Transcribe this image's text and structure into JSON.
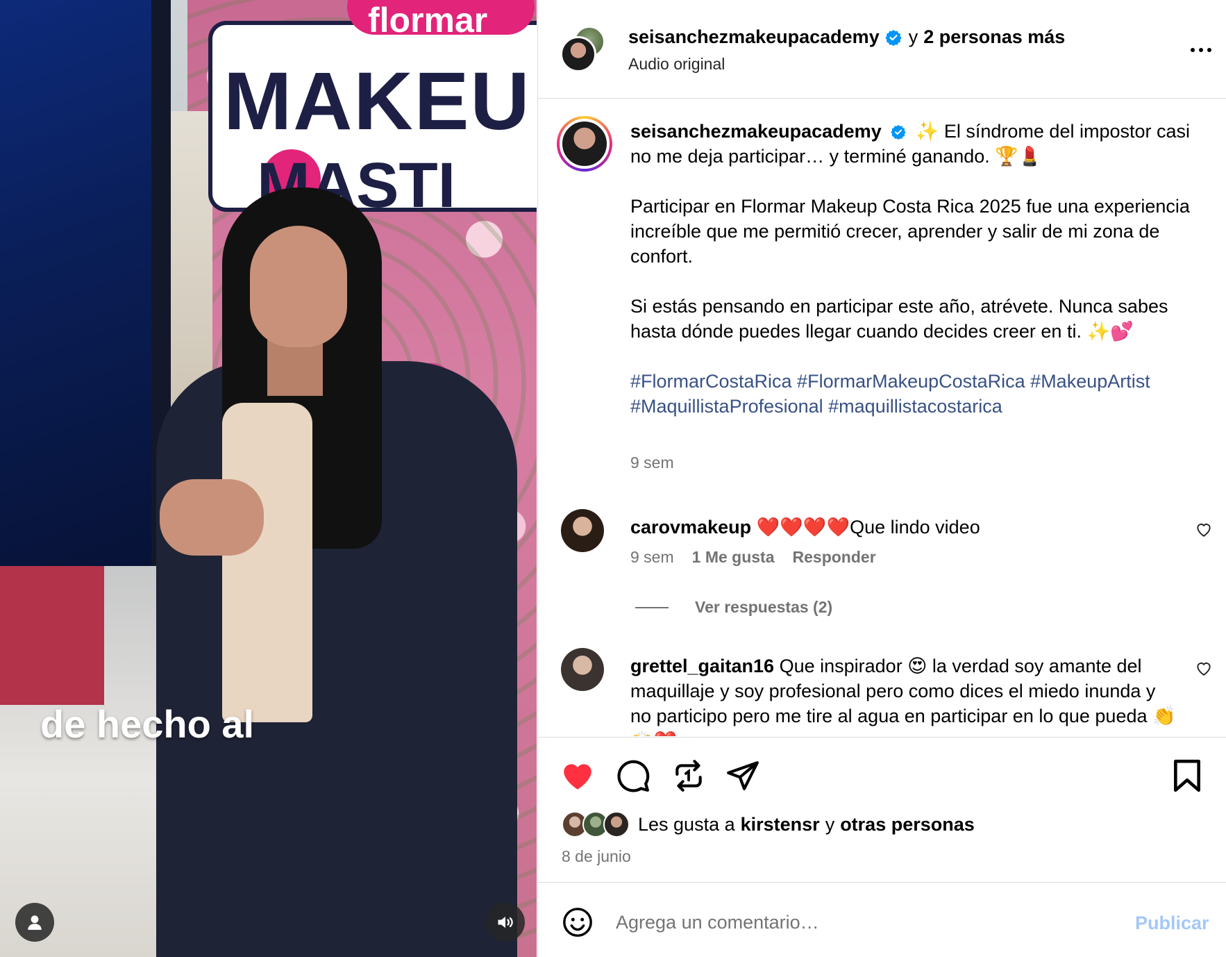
{
  "video": {
    "banner_brand": "flormar",
    "banner_line1": "MAKEU",
    "banner_line2": "MASTI",
    "caption": "de hecho al"
  },
  "header": {
    "username": "seisanchezmakeupacademy",
    "connector": "y",
    "others": "2 personas más",
    "audio": "Audio original"
  },
  "post": {
    "username": "seisanchezmakeupacademy",
    "paragraphs": [
      "✨ El síndrome del impostor casi no me deja participar… y terminé ganando. 🏆💄",
      "Participar en Flormar Makeup Costa Rica 2025 fue una experiencia increíble que me permitió crecer, aprender y salir de mi zona de confort.",
      "Si estás pensando en participar este año, atrévete. Nunca sabes hasta dónde puedes llegar cuando decides creer en ti. ✨💕"
    ],
    "hashtags": "#FlormarCostaRica #FlormarMakeupCostaRica #MakeupArtist #MaquillistaProfesional #maquillistacostarica",
    "time": "9 sem"
  },
  "comments": [
    {
      "username": "carovmakeup",
      "text": "❤️❤️❤️❤️Que lindo video",
      "time": "9 sem",
      "likes": "1 Me gusta",
      "reply": "Responder",
      "view_replies": "Ver respuestas (2)"
    },
    {
      "username": "grettel_gaitan16",
      "text": "Que inspirador 😍 la verdad soy amante del maquillaje y soy profesional pero como dices el miedo inunda y no participo pero me tire al agua en participar en lo que pueda 👏🙌❤️"
    }
  ],
  "likes": {
    "prefix": "Les gusta a",
    "user": "kirstensr",
    "connector": "y",
    "others": "otras personas",
    "date": "8 de junio"
  },
  "composer": {
    "placeholder": "Agrega un comentario…",
    "publish": "Publicar"
  },
  "colors": {
    "like_red": "#ff3040",
    "verified_blue": "#0095f6",
    "hashtag_blue": "#385185",
    "publish_disabled": "#a4c8f5",
    "meta_gray": "#737373"
  },
  "icons": [
    "verified-icon",
    "more-icon",
    "heart-icon",
    "comment-icon",
    "repost-icon",
    "share-icon",
    "bookmark-icon",
    "emoji-icon",
    "user-tag-icon",
    "audio-icon"
  ]
}
